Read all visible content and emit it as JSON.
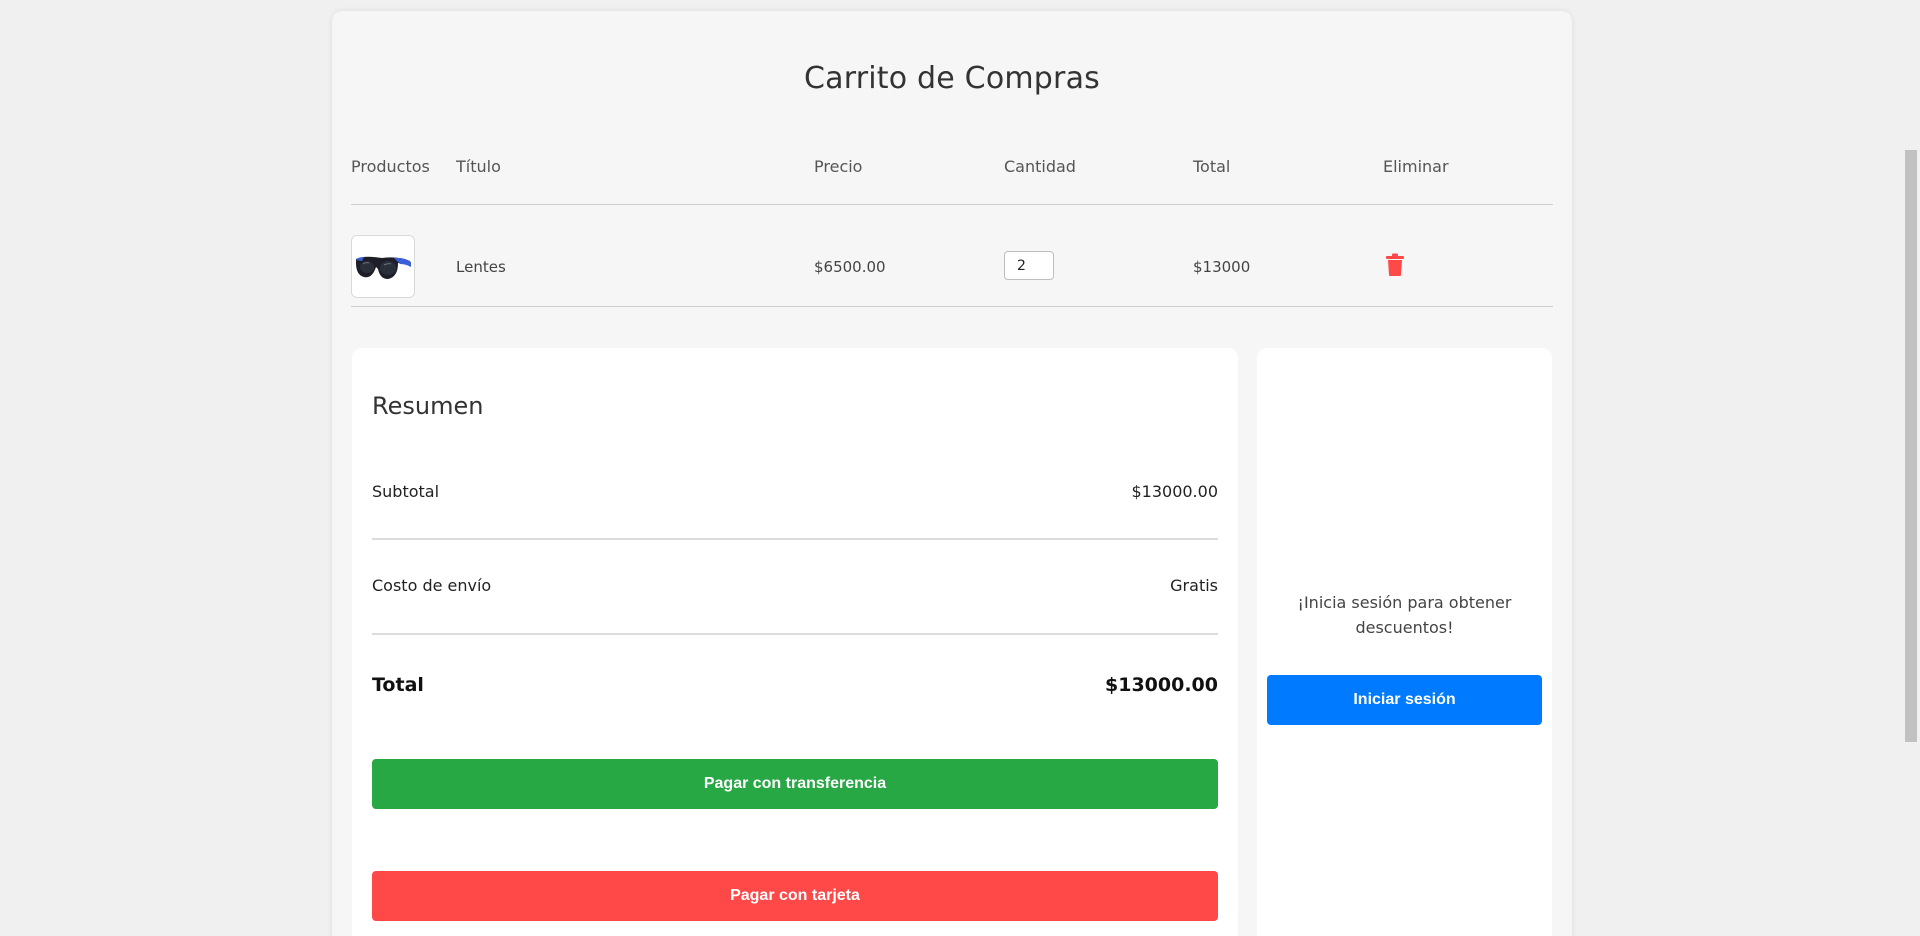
{
  "page": {
    "title": "Carrito de Compras"
  },
  "table": {
    "headers": {
      "productos": "Productos",
      "titulo": "Título",
      "precio": "Precio",
      "cantidad": "Cantidad",
      "total": "Total",
      "eliminar": "Eliminar"
    },
    "rows": [
      {
        "image_icon": "sunglasses-image",
        "title": "Lentes",
        "price": "$6500.00",
        "quantity": "2",
        "total": "$13000",
        "delete_icon": "trash-icon"
      }
    ]
  },
  "summary": {
    "title": "Resumen",
    "subtotal_label": "Subtotal",
    "subtotal_value": "$13000.00",
    "shipping_label": "Costo de envío",
    "shipping_value": "Gratis",
    "total_label": "Total",
    "total_value": "$13000.00",
    "transfer_button": "Pagar con transferencia",
    "card_button": "Pagar con tarjeta"
  },
  "login": {
    "message": "¡Inicia sesión para obtener descuentos!",
    "button": "Iniciar sesión"
  },
  "colors": {
    "transfer": "#28a745",
    "card": "#ff4848",
    "login": "#007bff",
    "delete": "#ff4848"
  }
}
